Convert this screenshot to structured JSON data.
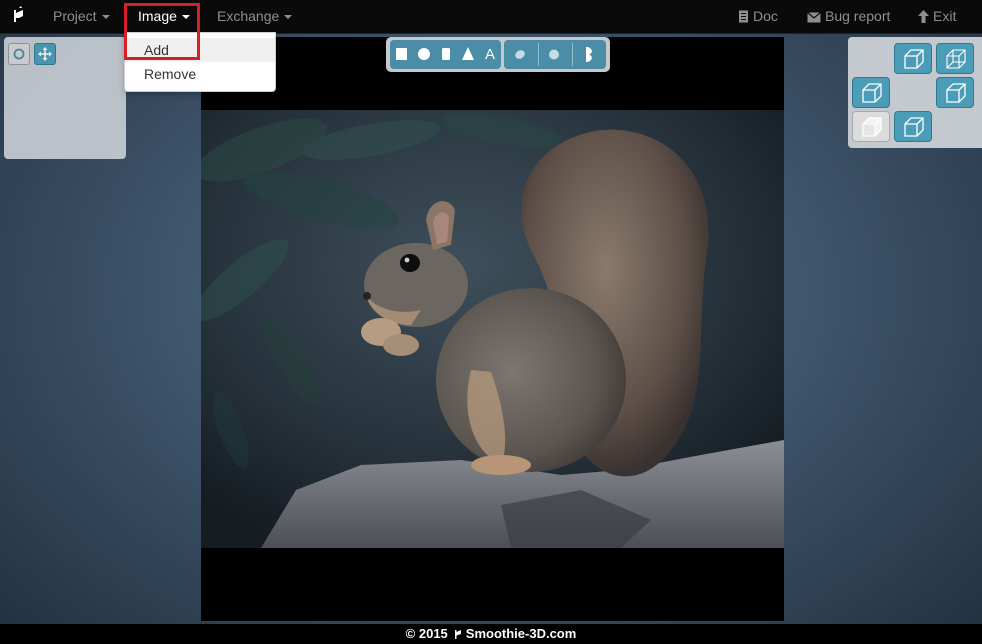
{
  "navbar": {
    "menus": [
      {
        "label": "Project"
      },
      {
        "label": "Image"
      },
      {
        "label": "Exchange"
      }
    ],
    "right_links": [
      {
        "label": "Doc",
        "icon": "document-icon"
      },
      {
        "label": "Bug report",
        "icon": "envelope-icon"
      },
      {
        "label": "Exit",
        "icon": "arrow-up-icon"
      }
    ]
  },
  "image_menu": {
    "items": [
      {
        "label": "Add"
      },
      {
        "label": "Remove"
      }
    ]
  },
  "left_panel": {
    "tools": [
      {
        "icon": "rotate-icon"
      },
      {
        "icon": "move-icon"
      }
    ]
  },
  "shape_toolbar": {
    "shapes": [
      "square",
      "circle",
      "cylinder",
      "cone",
      "text"
    ],
    "text_tool_label": "A",
    "extra": [
      "ellipse",
      "sphere",
      "half-shape"
    ]
  },
  "view_panel": {
    "views": [
      "top-view",
      "back-view",
      "left-view",
      "right-view",
      "front-view",
      "bottom-view"
    ]
  },
  "canvas": {
    "image_subject": "squirrel"
  },
  "footer": {
    "copyright": "© 2015",
    "site": "Smoothie-3D.com"
  },
  "colors": {
    "accent": "#4b9db7",
    "highlight": "#d62028",
    "navbar": "#0a0a0a"
  }
}
